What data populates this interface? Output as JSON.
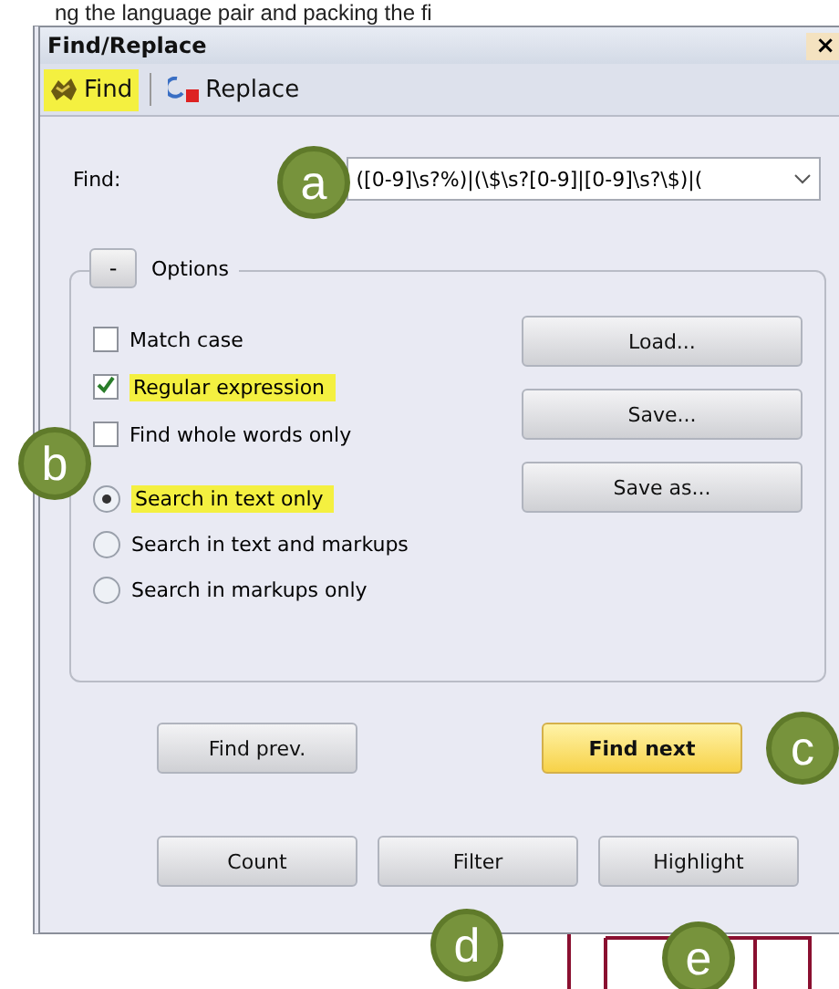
{
  "caption_fragment": "ng the language pair and packing the fi",
  "window": {
    "title": "Find/Replace",
    "close": "×"
  },
  "tabs": [
    {
      "label": "Find",
      "selected": true
    },
    {
      "label": "Replace",
      "selected": false
    }
  ],
  "find": {
    "label": "Find:",
    "value": "([0-9]\\s?%)|(\\$\\s?[0-9]|[0-9]\\s?\\$)|("
  },
  "options": {
    "toggle": "-",
    "title": "Options",
    "checkboxes": [
      {
        "label": "Match case",
        "checked": false,
        "highlighted": false
      },
      {
        "label": "Regular expression",
        "checked": true,
        "highlighted": true
      },
      {
        "label": "Find whole words only",
        "checked": false,
        "highlighted": false
      }
    ],
    "radios": [
      {
        "label": "Search in text only",
        "selected": true,
        "highlighted": true
      },
      {
        "label": "Search in text and markups",
        "selected": false,
        "highlighted": false
      },
      {
        "label": "Search in markups only",
        "selected": false,
        "highlighted": false
      }
    ],
    "side_buttons": [
      "Load...",
      "Save...",
      "Save as..."
    ]
  },
  "nav_buttons": [
    {
      "label": "Find prev.",
      "default": false
    },
    {
      "label": "Find next",
      "default": true
    }
  ],
  "action_buttons": [
    "Count",
    "Filter",
    "Highlight"
  ],
  "markers": [
    "a",
    "b",
    "c",
    "d",
    "e"
  ]
}
